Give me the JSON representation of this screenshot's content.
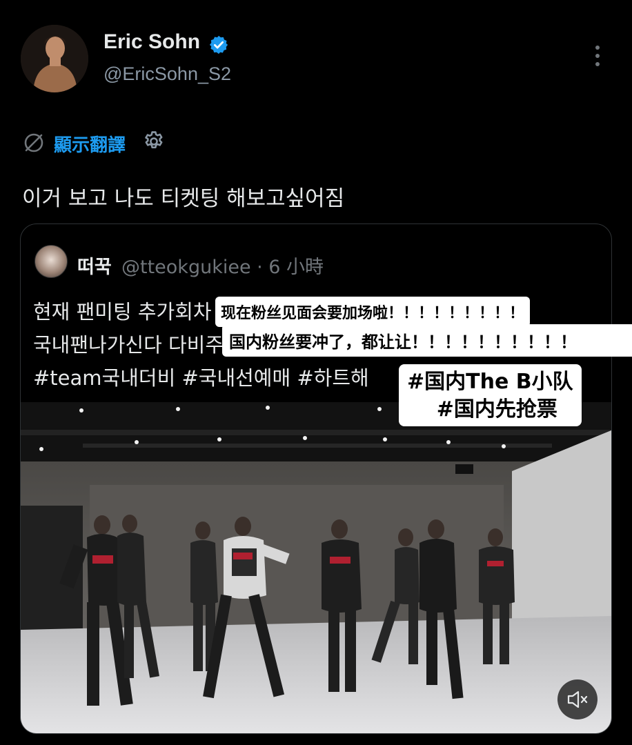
{
  "author": {
    "name": "Eric Sohn",
    "handle": "@EricSohn_S2",
    "verified": true
  },
  "icons": {
    "verified": "verified-badge-icon",
    "more": "more-options-icon",
    "translate": "translate-icon",
    "settings": "gear-icon",
    "mute": "speaker-muted-icon"
  },
  "translate": {
    "label": "顯示翻譯"
  },
  "tweet": {
    "text": "이거 보고 나도 티켓팅 해보고싶어짐"
  },
  "quote": {
    "name": "떠꾹",
    "meta": "@tteokgukiee · 6 小時",
    "line1": "현재 팬미팅 추가회차",
    "line2": "국내팬나가신다 다비주",
    "line3": "#team국내더비 #국내선예매 #하트해"
  },
  "overlays": {
    "caption1": "现在粉丝见面会要加场啦！！！！！！！！！",
    "caption2": "国内粉丝要冲了，都让让！！！！！！！！！！",
    "caption3_line1": "#国内The B小队",
    "caption3_line2": "#国内先抢票"
  },
  "colors": {
    "background": "#000000",
    "text": "#e7e9ea",
    "secondary": "#71767b",
    "link": "#1d9bf0",
    "verified": "#1d9bf0",
    "caption_bg": "#ffffff"
  }
}
